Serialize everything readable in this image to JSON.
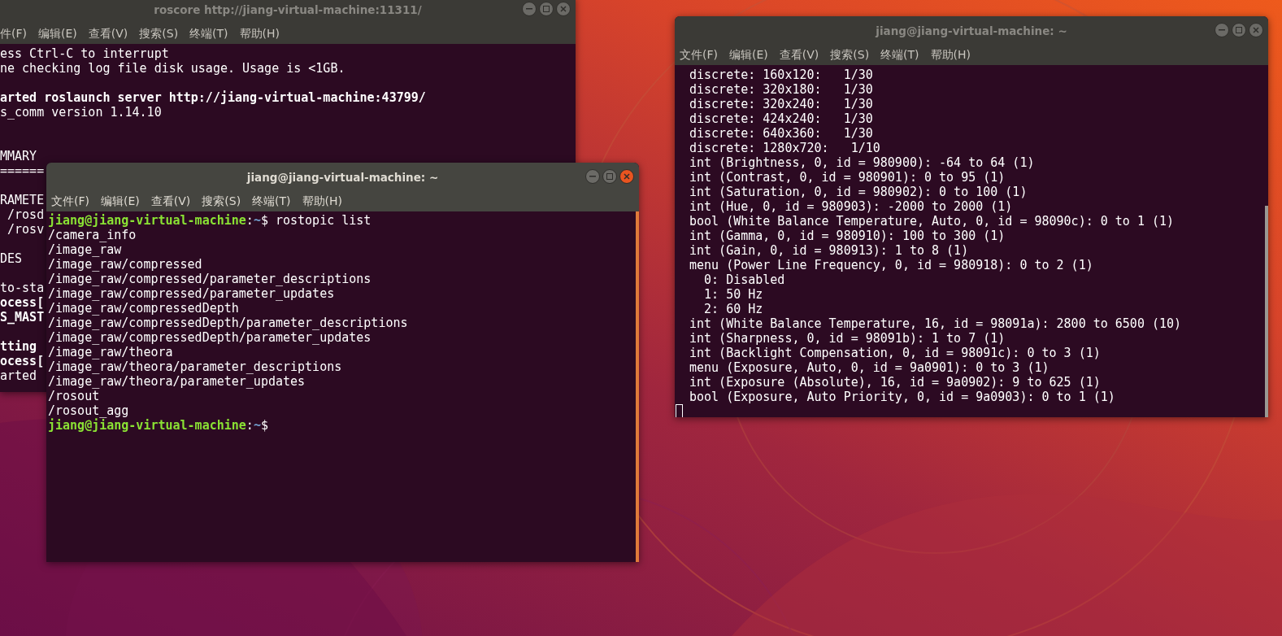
{
  "windows": [
    {
      "title": "roscore http://jiang-virtual-machine:11311/",
      "focused": false,
      "cursor": false,
      "menu": [
        "件(F)",
        "编辑(E)",
        "查看(V)",
        "搜索(S)",
        "终端(T)",
        "帮助(H)"
      ],
      "lines": [
        {
          "kind": "text",
          "text": "ess Ctrl-C to interrupt"
        },
        {
          "kind": "text",
          "text": "ne checking log file disk usage. Usage is <1GB."
        },
        {
          "kind": "blank"
        },
        {
          "kind": "bold",
          "text": "arted roslaunch server http://jiang-virtual-machine:43799/"
        },
        {
          "kind": "text",
          "text": "s_comm version 1.14.10"
        },
        {
          "kind": "blank"
        },
        {
          "kind": "blank"
        },
        {
          "kind": "text",
          "text": "MMARY"
        },
        {
          "kind": "text",
          "text": "======"
        },
        {
          "kind": "blank"
        },
        {
          "kind": "text",
          "text": "RAMETE"
        },
        {
          "kind": "text",
          "text": " /rosd"
        },
        {
          "kind": "text",
          "text": " /rosv"
        },
        {
          "kind": "blank"
        },
        {
          "kind": "text",
          "text": "DES"
        },
        {
          "kind": "blank"
        },
        {
          "kind": "text",
          "text": "to-sta"
        },
        {
          "kind": "bold",
          "text": "ocess["
        },
        {
          "kind": "bold",
          "text": "S_MAST"
        },
        {
          "kind": "blank"
        },
        {
          "kind": "bold",
          "text": "tting"
        },
        {
          "kind": "bold",
          "text": "ocess["
        },
        {
          "kind": "text",
          "text": "arted"
        }
      ]
    },
    {
      "title": "jiang@jiang-virtual-machine: ~",
      "focused": true,
      "cursor": false,
      "menu": [
        "文件(F)",
        "编辑(E)",
        "查看(V)",
        "搜索(S)",
        "终端(T)",
        "帮助(H)"
      ],
      "lines": [
        {
          "kind": "prompt",
          "user": "jiang@jiang-virtual-machine",
          "sep": ":",
          "path": "~",
          "dollar": "$",
          "command": " rostopic list"
        },
        {
          "kind": "text",
          "text": "/camera_info"
        },
        {
          "kind": "text",
          "text": "/image_raw"
        },
        {
          "kind": "text",
          "text": "/image_raw/compressed"
        },
        {
          "kind": "text",
          "text": "/image_raw/compressed/parameter_descriptions"
        },
        {
          "kind": "text",
          "text": "/image_raw/compressed/parameter_updates"
        },
        {
          "kind": "text",
          "text": "/image_raw/compressedDepth"
        },
        {
          "kind": "text",
          "text": "/image_raw/compressedDepth/parameter_descriptions"
        },
        {
          "kind": "text",
          "text": "/image_raw/compressedDepth/parameter_updates"
        },
        {
          "kind": "text",
          "text": "/image_raw/theora"
        },
        {
          "kind": "text",
          "text": "/image_raw/theora/parameter_descriptions"
        },
        {
          "kind": "text",
          "text": "/image_raw/theora/parameter_updates"
        },
        {
          "kind": "text",
          "text": "/rosout"
        },
        {
          "kind": "text",
          "text": "/rosout_agg"
        },
        {
          "kind": "prompt",
          "user": "jiang@jiang-virtual-machine",
          "sep": ":",
          "path": "~",
          "dollar": "$"
        }
      ]
    },
    {
      "title": "jiang@jiang-virtual-machine: ~",
      "focused": false,
      "cursor": true,
      "menu": [
        "文件(F)",
        "编辑(E)",
        "查看(V)",
        "搜索(S)",
        "终端(T)",
        "帮助(H)"
      ],
      "lines": [
        {
          "kind": "text",
          "text": "discrete: 160x120:   1/30"
        },
        {
          "kind": "text",
          "text": "discrete: 320x180:   1/30"
        },
        {
          "kind": "text",
          "text": "discrete: 320x240:   1/30"
        },
        {
          "kind": "text",
          "text": "discrete: 424x240:   1/30"
        },
        {
          "kind": "text",
          "text": "discrete: 640x360:   1/30"
        },
        {
          "kind": "text",
          "text": "discrete: 1280x720:   1/10"
        },
        {
          "kind": "text",
          "text": "int (Brightness, 0, id = 980900): -64 to 64 (1)"
        },
        {
          "kind": "text",
          "text": "int (Contrast, 0, id = 980901): 0 to 95 (1)"
        },
        {
          "kind": "text",
          "text": "int (Saturation, 0, id = 980902): 0 to 100 (1)"
        },
        {
          "kind": "text",
          "text": "int (Hue, 0, id = 980903): -2000 to 2000 (1)"
        },
        {
          "kind": "text",
          "text": "bool (White Balance Temperature, Auto, 0, id = 98090c): 0 to 1 (1)"
        },
        {
          "kind": "text",
          "text": "int (Gamma, 0, id = 980910): 100 to 300 (1)"
        },
        {
          "kind": "text",
          "text": "int (Gain, 0, id = 980913): 1 to 8 (1)"
        },
        {
          "kind": "text",
          "text": "menu (Power Line Frequency, 0, id = 980918): 0 to 2 (1)"
        },
        {
          "kind": "text",
          "text": "  0: Disabled"
        },
        {
          "kind": "text",
          "text": "  1: 50 Hz"
        },
        {
          "kind": "text",
          "text": "  2: 60 Hz"
        },
        {
          "kind": "text",
          "text": "int (White Balance Temperature, 16, id = 98091a): 2800 to 6500 (10)"
        },
        {
          "kind": "text",
          "text": "int (Sharpness, 0, id = 98091b): 1 to 7 (1)"
        },
        {
          "kind": "text",
          "text": "int (Backlight Compensation, 0, id = 98091c): 0 to 3 (1)"
        },
        {
          "kind": "text",
          "text": "menu (Exposure, Auto, 0, id = 9a0901): 0 to 3 (1)"
        },
        {
          "kind": "text",
          "text": "int (Exposure (Absolute), 16, id = 9a0902): 9 to 625 (1)"
        },
        {
          "kind": "text",
          "text": "bool (Exposure, Auto Priority, 0, id = 9a0903): 0 to 1 (1)"
        }
      ]
    }
  ]
}
